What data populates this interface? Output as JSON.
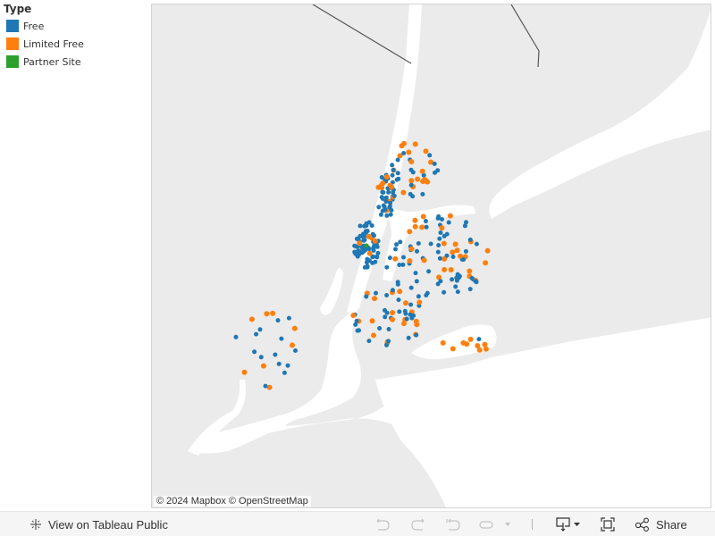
{
  "legend": {
    "title": "Type",
    "items": [
      {
        "label": "Free",
        "color": "#1f77b4"
      },
      {
        "label": "Limited Free",
        "color": "#ff7f0e"
      },
      {
        "label": "Partner Site",
        "color": "#2ca02c"
      }
    ]
  },
  "map": {
    "attribution": "© 2024 Mapbox  © OpenStreetMap",
    "land_color": "#ebebeb",
    "water_color": "#ffffff",
    "region": "New York City",
    "marker_types": [
      "Free",
      "Limited Free",
      "Partner Site"
    ]
  },
  "toolbar": {
    "view_on_public": "View on Tableau Public",
    "undo": "undo-icon",
    "redo": "redo-icon",
    "revert": "revert-icon",
    "refresh": "refresh-icon",
    "download": "download-icon",
    "fullscreen": "fullscreen-icon",
    "share": "Share"
  }
}
